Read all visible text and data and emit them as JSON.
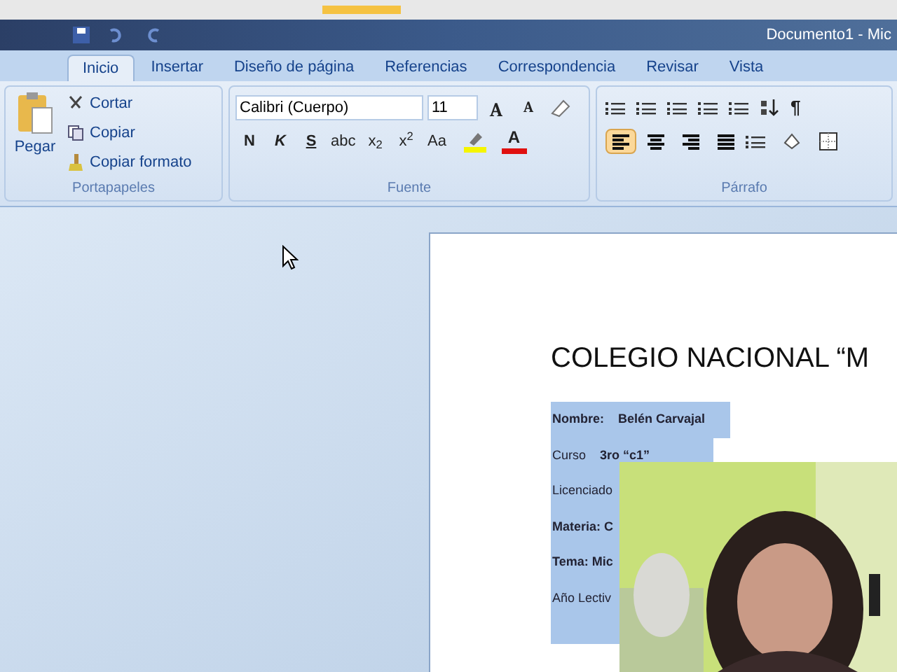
{
  "window": {
    "title": "Documento1 - Mic"
  },
  "tabs": [
    {
      "label": "Inicio",
      "selected": true
    },
    {
      "label": "Insertar",
      "selected": false
    },
    {
      "label": "Diseño de página",
      "selected": false
    },
    {
      "label": "Referencias",
      "selected": false
    },
    {
      "label": "Correspondencia",
      "selected": false
    },
    {
      "label": "Revisar",
      "selected": false
    },
    {
      "label": "Vista",
      "selected": false
    }
  ],
  "clipboard": {
    "title": "Portapapeles",
    "paste": "Pegar",
    "items": [
      {
        "kind": "cut",
        "label": "Cortar"
      },
      {
        "kind": "copy",
        "label": "Copiar"
      },
      {
        "kind": "brush",
        "label": "Copiar formato"
      }
    ]
  },
  "font": {
    "title": "Fuente",
    "family": "Calibri (Cuerpo)",
    "size": "11",
    "size_buttons": [
      "A",
      "A"
    ],
    "format_buttons": [
      "N",
      "K",
      "S",
      "abc",
      "x$_{2}$",
      "x$^{2}$",
      "Aa"
    ],
    "color_label": "A"
  },
  "paragraph": {
    "title": "Párrafo",
    "pilcrow": "¶",
    "alignments": [
      {
        "kind": "left",
        "selected": true
      },
      {
        "kind": "center",
        "selected": false
      },
      {
        "kind": "right",
        "selected": false
      },
      {
        "kind": "justify",
        "selected": false
      }
    ]
  },
  "document": {
    "heading": "COLEGIO NACIONAL “M",
    "fields": [
      {
        "label": "Nombre:",
        "value": "Belén Carvajal",
        "bold": true
      },
      {
        "label": "Curso",
        "value": "3ro “c1”",
        "bold": false
      },
      {
        "label": "Licenciado",
        "bold": false
      },
      {
        "label": "Materia: C",
        "bold": true
      },
      {
        "label": "Tema: Mic",
        "bold": true
      },
      {
        "label": "Año Lectiv",
        "bold": false
      }
    ]
  }
}
